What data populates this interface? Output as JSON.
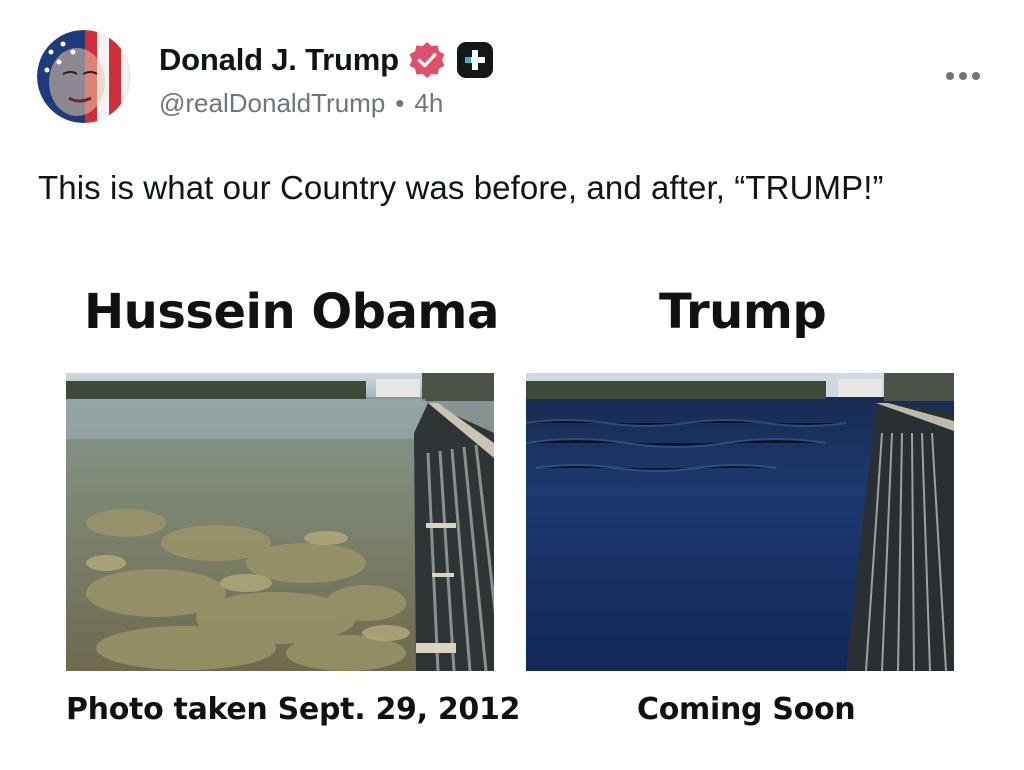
{
  "post": {
    "author": {
      "display_name": "Donald J. Trump",
      "handle": "@realDonaldTrump",
      "time": "4h",
      "separator": "•",
      "verified_icon": "verified-badge-icon",
      "app_icon": "plus-badge-icon"
    },
    "text": "This is what our Country was before, and after, “TRUMP!”",
    "more_icon": "more-options-icon",
    "media": {
      "left": {
        "title": "Hussein Obama",
        "caption": "Photo taken Sept. 29, 2012"
      },
      "right": {
        "title": "Trump",
        "caption": "Coming Soon"
      }
    }
  },
  "colors": {
    "text": "#0f1419",
    "secondary_text": "#6e767d",
    "verified_badge": "#e0506a",
    "app_badge": "#14171a"
  }
}
